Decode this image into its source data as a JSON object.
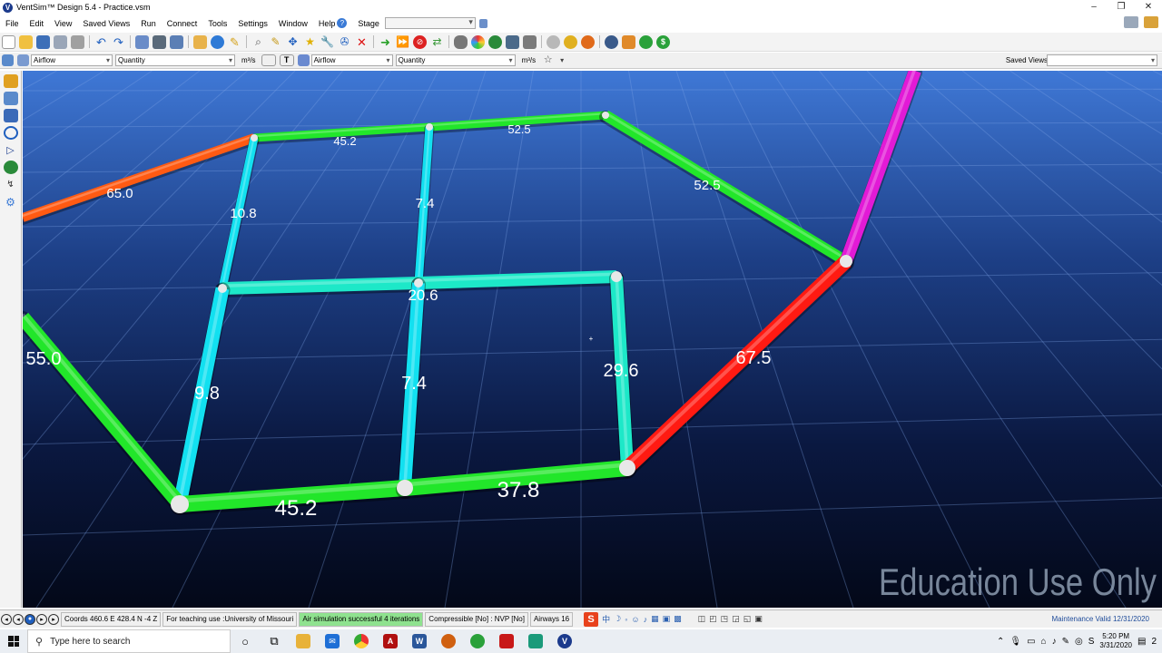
{
  "window": {
    "title": "VentSim™ Design 5.4 - Practice.vsm",
    "controls": [
      "–",
      "❐",
      "✕"
    ]
  },
  "menu": {
    "items": [
      "File",
      "Edit",
      "View",
      "Saved Views",
      "Run",
      "Connect",
      "Tools",
      "Settings",
      "Window",
      "Help"
    ],
    "help_glyph": "?",
    "stage_label": "Stage",
    "stage_value": ""
  },
  "toolbar2": {
    "dd1": "Airflow",
    "dd2": "Quantity",
    "unit1": "m³/s",
    "btn_t": "T",
    "dd3": "Airflow",
    "dd4": "Quantity",
    "unit2": "m³/s",
    "saved_views_label": "Saved Views",
    "saved_views_value": ""
  },
  "viewport": {
    "watermark": "Education Use Only",
    "colors": {
      "green": "#22e62a",
      "cyan": "#12e0f0",
      "mint": "#1de8c8",
      "orange": "#ff5a12",
      "red": "#ff1a12",
      "magenta": "#e21ad6"
    },
    "labels": {
      "top_left": "45.2",
      "top_right": "52.5",
      "right_diag": "52.5",
      "orange": "65.0",
      "left_cyan_top": "10.8",
      "mid_cyan_top": "7.4",
      "mid_horizontal": "20.6",
      "left_cyan_bottom": "9.8",
      "mid_cyan_bottom": "7.4",
      "right_cyan": "29.6",
      "red": "67.5",
      "left_green": "55.0",
      "bottom_left": "45.2",
      "bottom_right": "37.8"
    }
  },
  "status": {
    "coords": "Coords 460.6 E    428.4 N   -4 Z",
    "teaching": "For teaching use :University of Missouri",
    "simulation": "Air simulation successful 4 iterations",
    "compressible": "Compressible [No] : NVP [No]",
    "airways": "Airways 16",
    "ime_logo": "S",
    "ime_text": "中",
    "maintenance": "Maintenance Valid 12/31/2020"
  },
  "taskbar": {
    "search_placeholder": "Type here to search",
    "time": "5:20 PM",
    "date": "3/31/2020",
    "notification_count": "2"
  }
}
